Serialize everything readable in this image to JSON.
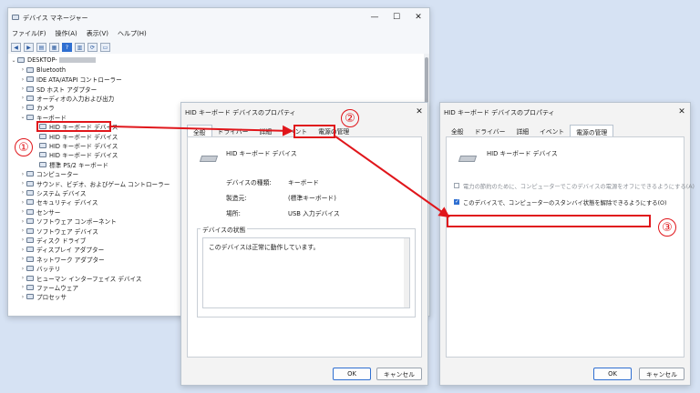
{
  "device_manager": {
    "title": "デバイス マネージャー",
    "menu": [
      "ファイル(F)",
      "操作(A)",
      "表示(V)",
      "ヘルプ(H)"
    ],
    "root": "DESKTOP-",
    "tree": [
      {
        "label": "Bluetooth",
        "icon": "bluetooth-icon",
        "level": 1,
        "expanded": false
      },
      {
        "label": "IDE ATA/ATAPI コントローラー",
        "icon": "ide-controller-icon",
        "level": 1,
        "expanded": false
      },
      {
        "label": "SD ホスト アダプター",
        "icon": "sd-host-icon",
        "level": 1,
        "expanded": false
      },
      {
        "label": "オーディオの入力および出力",
        "icon": "speaker-icon",
        "level": 1,
        "expanded": false
      },
      {
        "label": "カメラ",
        "icon": "camera-icon",
        "level": 1,
        "expanded": false
      },
      {
        "label": "キーボード",
        "icon": "keyboard-icon",
        "level": 1,
        "expanded": true
      },
      {
        "label": "HID キーボード デバイス",
        "icon": "keyboard-icon",
        "level": 2,
        "expanded": null
      },
      {
        "label": "HID キーボード デバイス",
        "icon": "keyboard-icon",
        "level": 2,
        "expanded": null
      },
      {
        "label": "HID キーボード デバイス",
        "icon": "keyboard-icon",
        "level": 2,
        "expanded": null
      },
      {
        "label": "HID キーボード デバイス",
        "icon": "keyboard-icon",
        "level": 2,
        "expanded": null
      },
      {
        "label": "標準 PS/2 キーボード",
        "icon": "keyboard-icon",
        "level": 2,
        "expanded": null
      },
      {
        "label": "コンピューター",
        "icon": "computer-icon",
        "level": 1,
        "expanded": false
      },
      {
        "label": "サウンド、ビデオ、およびゲーム コントローラー",
        "icon": "sound-icon",
        "level": 1,
        "expanded": false
      },
      {
        "label": "システム デバイス",
        "icon": "system-device-icon",
        "level": 1,
        "expanded": false
      },
      {
        "label": "セキュリティ デバイス",
        "icon": "security-icon",
        "level": 1,
        "expanded": false
      },
      {
        "label": "センサー",
        "icon": "sensor-icon",
        "level": 1,
        "expanded": false
      },
      {
        "label": "ソフトウェア コンポーネント",
        "icon": "software-component-icon",
        "level": 1,
        "expanded": false
      },
      {
        "label": "ソフトウェア デバイス",
        "icon": "software-device-icon",
        "level": 1,
        "expanded": false
      },
      {
        "label": "ディスク ドライブ",
        "icon": "disk-drive-icon",
        "level": 1,
        "expanded": false
      },
      {
        "label": "ディスプレイ アダプター",
        "icon": "display-adapter-icon",
        "level": 1,
        "expanded": false
      },
      {
        "label": "ネットワーク アダプター",
        "icon": "network-adapter-icon",
        "level": 1,
        "expanded": false
      },
      {
        "label": "バッテリ",
        "icon": "battery-icon",
        "level": 1,
        "expanded": false
      },
      {
        "label": "ヒューマン インターフェイス デバイス",
        "icon": "hid-icon",
        "level": 1,
        "expanded": false
      },
      {
        "label": "ファームウェア",
        "icon": "firmware-icon",
        "level": 1,
        "expanded": false
      },
      {
        "label": "プロセッサ",
        "icon": "processor-icon",
        "level": 1,
        "expanded": false
      }
    ]
  },
  "props_general": {
    "title": "HID キーボード デバイスのプロパティ",
    "tabs": [
      "全般",
      "ドライバー",
      "詳細",
      "イベント",
      "電源の管理"
    ],
    "device_name": "HID キーボード デバイス",
    "fields": [
      {
        "label": "デバイスの種類:",
        "value": "キーボード"
      },
      {
        "label": "製造元:",
        "value": "(標準キーボード)"
      },
      {
        "label": "場所:",
        "value": "USB 入力デバイス"
      }
    ],
    "status_group": "デバイスの状態",
    "status_text": "このデバイスは正常に動作しています。",
    "ok": "OK",
    "cancel": "キャンセル"
  },
  "props_power": {
    "title": "HID キーボード デバイスのプロパティ",
    "tabs": [
      "全般",
      "ドライバー",
      "詳細",
      "イベント",
      "電源の管理"
    ],
    "device_name": "HID キーボード デバイス",
    "opt_power_off": "電力の節約のために、コンピューターでこのデバイスの電源をオフにできるようにする(A)",
    "opt_wake": "このデバイスで、コンピューターのスタンバイ状態を解除できるようにする(O)",
    "opt_power_off_checked": false,
    "opt_wake_checked": true,
    "ok": "OK",
    "cancel": "キャンセル"
  },
  "annotations": {
    "step1": "①",
    "step2": "②",
    "step3": "③",
    "color": "#e0161b"
  },
  "window_controls": {
    "minimize": "—",
    "maximize": "☐",
    "close": "✕"
  }
}
